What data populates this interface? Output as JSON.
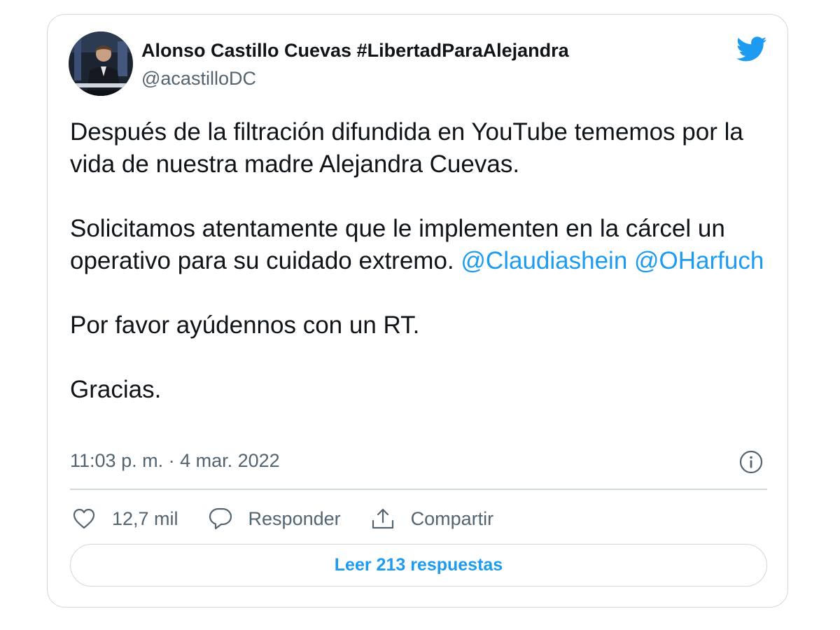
{
  "author": {
    "display_name": "Alonso Castillo Cuevas #LibertadParaAlejandra",
    "handle": "@acastilloDC",
    "avatar_icon": "avatar-photo"
  },
  "brand": {
    "icon": "twitter-bird-icon",
    "color": "#1d9bf0"
  },
  "tweet": {
    "p1": "Después de la filtración difundida en YouTube  tememos por la vida de nuestra madre Alejandra Cuevas.",
    "p2_text": "Solicitamos atentamente que le implementen en la cárcel un operativo para su cuidado extremo.",
    "mention_1": "@Claudiashein",
    "mention_2": "@OHarfuch",
    "p3": "Por favor ayúdennos con un RT.",
    "p4": "Gracias."
  },
  "meta": {
    "timestamp": "11:03 p. m. · 4 mar. 2022",
    "info_icon": "info-icon"
  },
  "actions": {
    "likes_count": "12,7 mil",
    "reply_label": "Responder",
    "share_label": "Compartir"
  },
  "replies": {
    "button_label": "Leer 213 respuestas"
  },
  "colors": {
    "text": "#0f1419",
    "secondary": "#536471",
    "link": "#1d9bf0",
    "border": "#cfd9de"
  }
}
